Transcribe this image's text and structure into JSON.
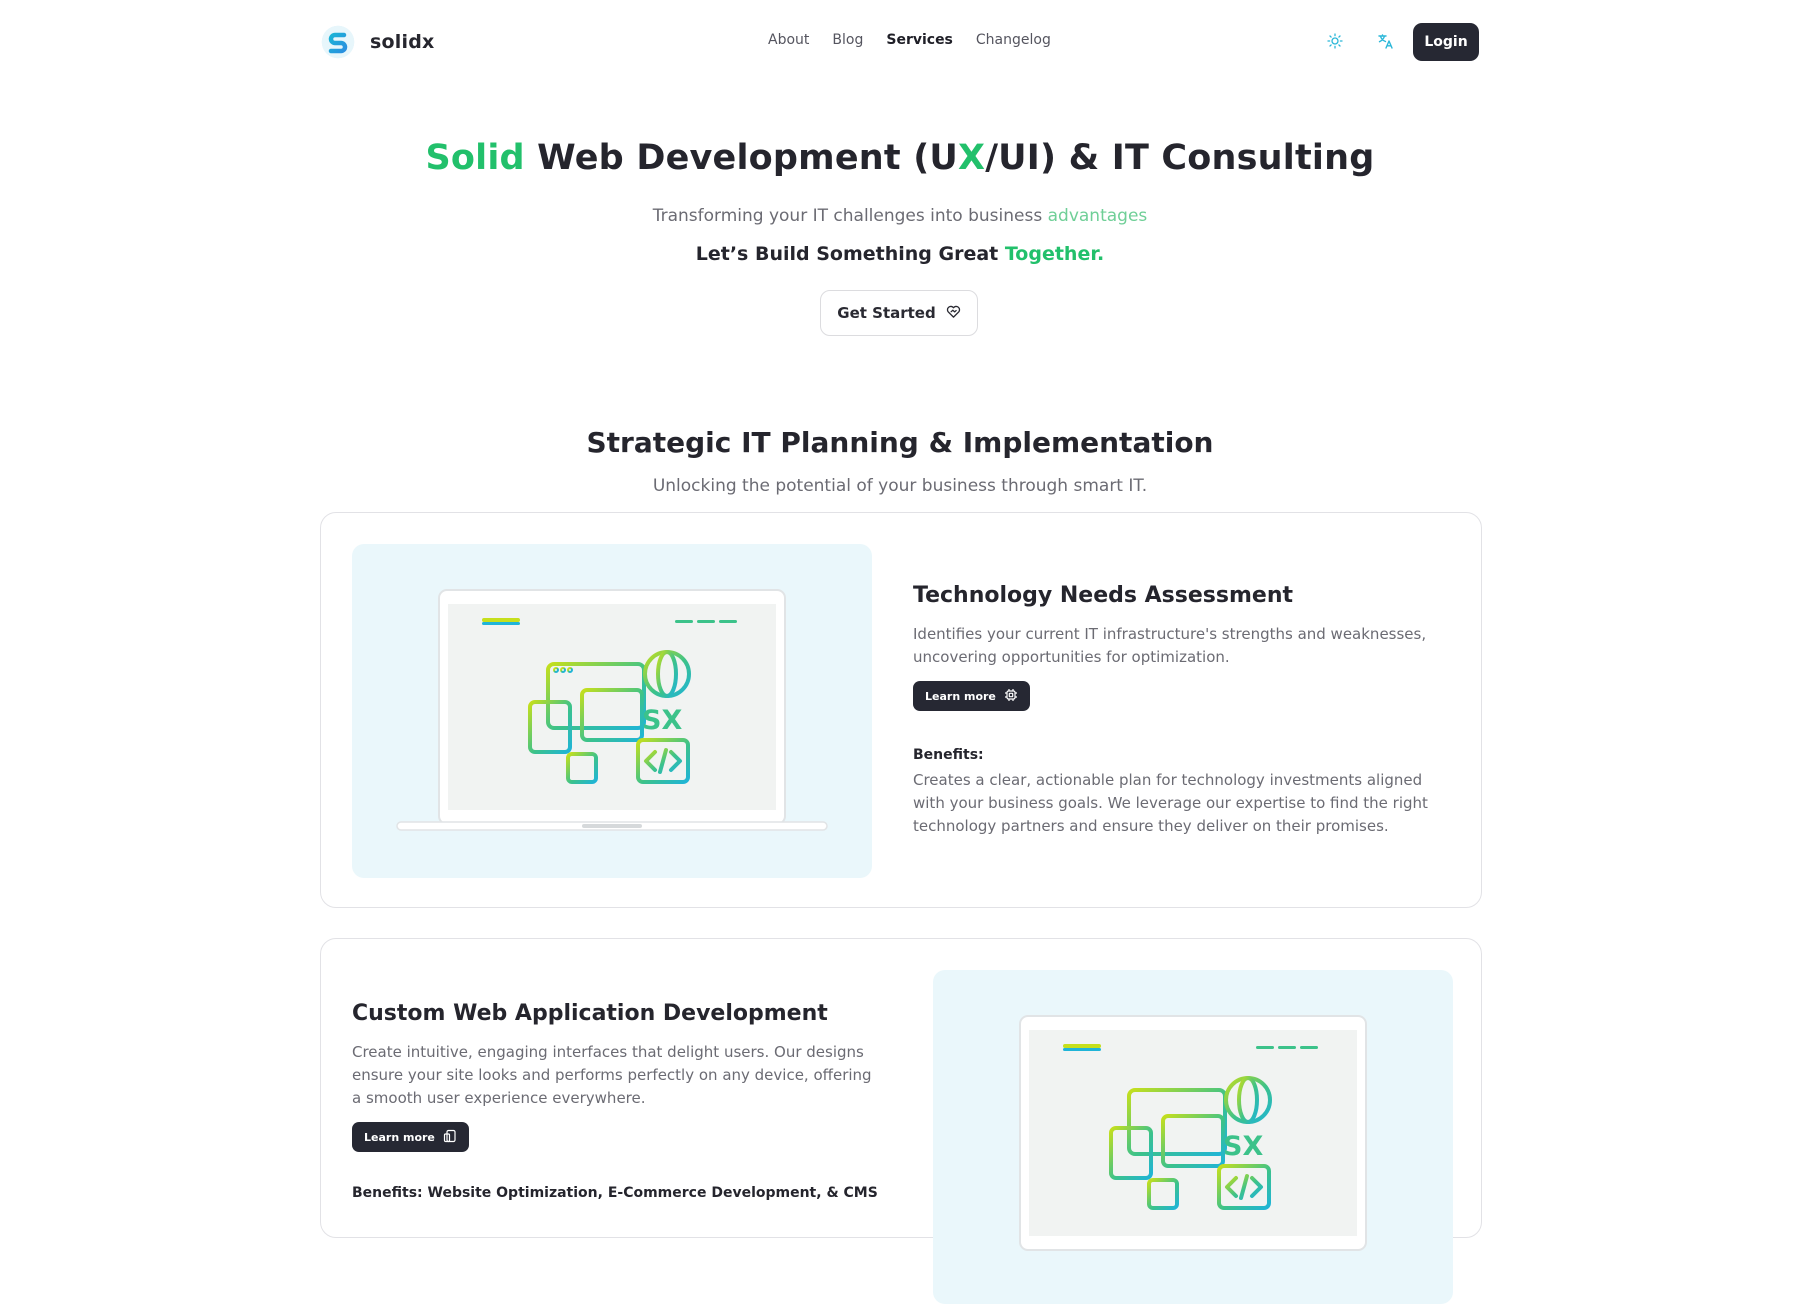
{
  "brand": {
    "name": "solidx",
    "logo_icon": "solidx-logo-icon",
    "logo_letter": "S"
  },
  "nav": {
    "items": [
      "About",
      "Blog",
      "Services",
      "Changelog"
    ],
    "active": "Services"
  },
  "header_actions": {
    "theme_icon": "sun-icon",
    "language_icon": "translate-icon",
    "login_label": "Login"
  },
  "hero": {
    "title_part1": "Solid",
    "title_part2": " Web Development (U",
    "title_part3": "X",
    "title_part4": "/UI) & IT Consulting",
    "subtitle_part1": "Transforming your IT challenges into business ",
    "subtitle_part2": "advantages",
    "tagline_part1": "Let’s Build Something Great ",
    "tagline_part2": "Together.",
    "cta_label": "Get Started",
    "cta_icon": "heart-handshake-icon"
  },
  "section": {
    "title": "Strategic IT Planning & Implementation",
    "subtitle": "Unlocking the potential of your business through smart IT."
  },
  "illustration": {
    "text": "SX"
  },
  "cards": [
    {
      "title": "Technology Needs Assessment",
      "description": "Identifies your current IT infrastructure's strengths and weaknesses, uncovering opportunities for optimization.",
      "learn_more": "Learn more",
      "learn_icon": "cpu-icon",
      "benefits_label": "Benefits:",
      "benefits_text": "Creates a clear, actionable plan for technology investments aligned with your business goals. We leverage our expertise to find the right technology partners and ensure they deliver on their promises."
    },
    {
      "title": "Custom Web Application Development",
      "description": "Create intuitive, engaging interfaces that delight users. Our designs ensure your site looks and performs perfectly on any device, offering a smooth user experience everywhere.",
      "learn_more": "Learn more",
      "learn_icon": "devices-icon",
      "benefits_label": "Benefits: Website Optimization, E-Commerce Development, & CMS"
    }
  ],
  "colors": {
    "accent_green": "#22c06b",
    "dark_button": "#262833",
    "illus_bg": "#eaf7fb"
  }
}
